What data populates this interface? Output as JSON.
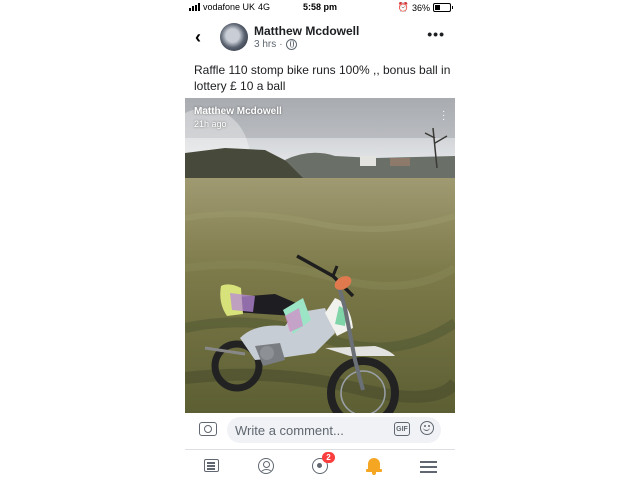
{
  "status_bar": {
    "carrier": "vodafone UK",
    "network": "4G",
    "time": "5:58 pm",
    "battery": "36%",
    "battery_level": 0.36
  },
  "post": {
    "author": "Matthew Mcdowell",
    "time_ago": "3 hrs",
    "separator": "·",
    "audience_icon": "globe-icon",
    "caption": "Raffle 110 stomp bike runs 100% ,, bonus ball in lottery £ 10 a ball"
  },
  "photo_overlay": {
    "name": "Matthew Mcdowell",
    "time": "21h ago"
  },
  "comment_bar": {
    "placeholder": "Write a comment...",
    "gif_label": "GIF"
  },
  "tab_bar": {
    "items": [
      {
        "name": "feed",
        "icon": "news-feed-icon"
      },
      {
        "name": "profile",
        "icon": "profile-icon"
      },
      {
        "name": "groups",
        "icon": "groups-icon",
        "badge": "2"
      },
      {
        "name": "notifications",
        "icon": "bell-icon",
        "active_color": "#f5a623"
      },
      {
        "name": "menu",
        "icon": "menu-icon"
      }
    ]
  },
  "colors": {
    "text_primary": "#1c1e21",
    "text_secondary": "#606770",
    "badge": "#fa3e3e",
    "active_tab": "#f5a623"
  }
}
